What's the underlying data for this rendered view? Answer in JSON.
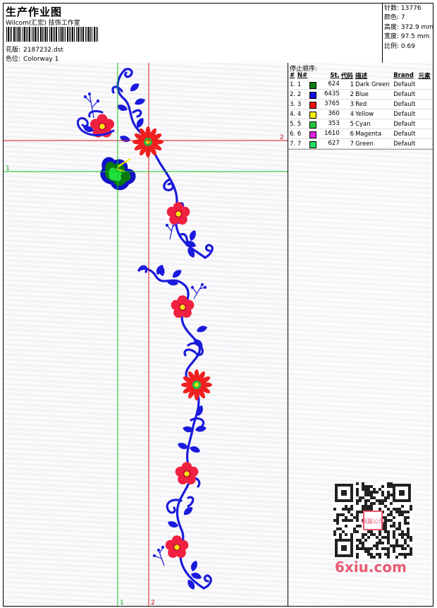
{
  "header": {
    "title": "生产作业图",
    "subtitle": "Wilcom(汇宏) 技饰工作室",
    "design_label": "花版:",
    "design_value": "2187232.dst",
    "colorway_label": "色位:",
    "colorway_value": "Colorway 1"
  },
  "stats": {
    "stitches_label": "针数:",
    "stitches_value": "13776",
    "colors_label": "颜色:",
    "colors_value": "7",
    "height_label": "高度:",
    "height_value": "372.9 mm",
    "width_label": "宽度:",
    "width_value": "97.5 mm",
    "scale_label": "比例:",
    "scale_value": "0.69"
  },
  "guides": {
    "horizontal_1": "1",
    "horizontal_2": "2",
    "vertical_1": "1",
    "vertical_2": "2"
  },
  "stop_sequence": {
    "title": "停止顺序:",
    "columns": [
      "#",
      "N#",
      "St.",
      "代码",
      "描述",
      "Brand",
      "元素"
    ],
    "rows": [
      {
        "idx": "1.",
        "n": "1",
        "color": "#0a7a10",
        "st": "624",
        "code": "1",
        "desc": "Dark Green",
        "brand": "Default"
      },
      {
        "idx": "2.",
        "n": "2",
        "color": "#1010e0",
        "st": "6435",
        "code": "2",
        "desc": "Blue",
        "brand": "Default"
      },
      {
        "idx": "3.",
        "n": "3",
        "color": "#f01010",
        "st": "3765",
        "code": "3",
        "desc": "Red",
        "brand": "Default"
      },
      {
        "idx": "4.",
        "n": "4",
        "color": "#f5f010",
        "st": "360",
        "code": "4",
        "desc": "Yellow",
        "brand": "Default"
      },
      {
        "idx": "5.",
        "n": "5",
        "color": "#20c840",
        "st": "353",
        "code": "5",
        "desc": "Cyan",
        "brand": "Default"
      },
      {
        "idx": "6.",
        "n": "6",
        "color": "#e020e0",
        "st": "1610",
        "code": "6",
        "desc": "Magenta",
        "brand": "Default"
      },
      {
        "idx": "7.",
        "n": "7",
        "color": "#20e060",
        "st": "627",
        "code": "7",
        "desc": "Green",
        "brand": "Default"
      }
    ]
  },
  "watermark": {
    "logo_text": "6xiu.com",
    "qr_seal_text": "网赢公司"
  },
  "colors": {
    "blue": "#1a1adc",
    "red": "#f02040",
    "flower_center_yellow": "#f5e610",
    "flower_center_green": "#20c040",
    "leaf_dark_green": "#0a7a10",
    "leaf_blue": "#1010c8",
    "guide_red": "#e01818",
    "guide_green": "#10c818"
  }
}
